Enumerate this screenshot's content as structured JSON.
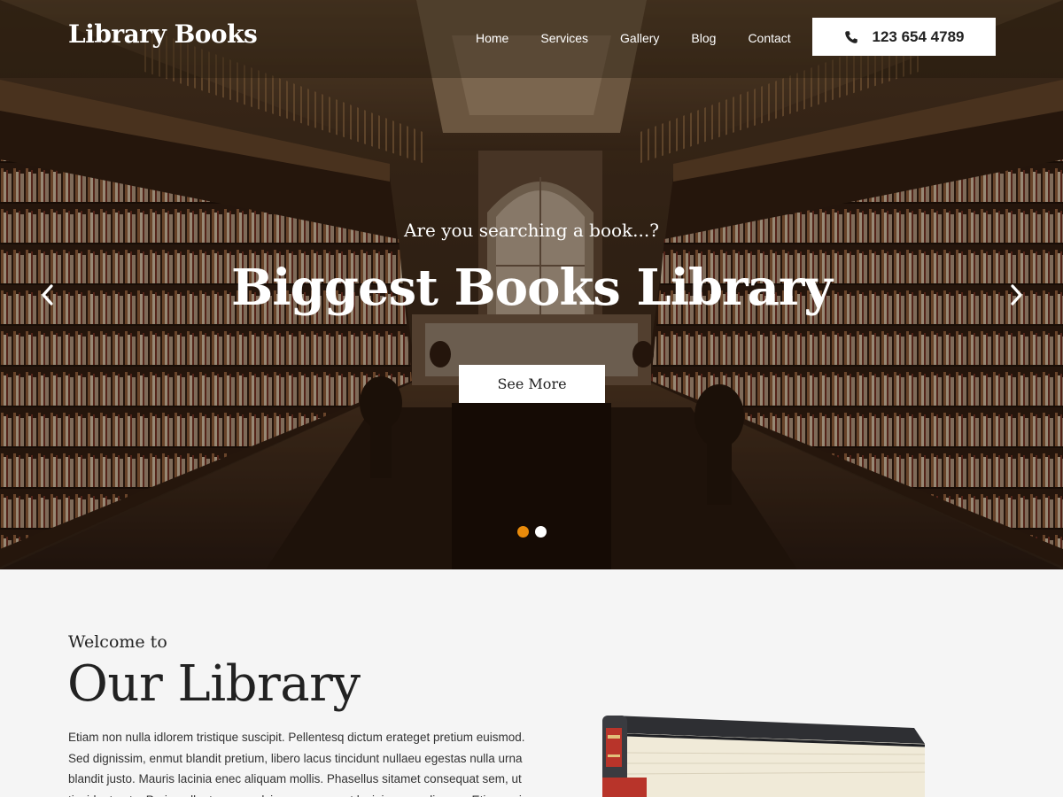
{
  "header": {
    "logo": "Library Books",
    "nav": [
      "Home",
      "Services",
      "Gallery",
      "Blog",
      "Contact"
    ],
    "phone": "123 654 4789"
  },
  "hero": {
    "subtitle": "Are you searching a book...?",
    "title": "Biggest Books Library",
    "button": "See More",
    "slides_total": 2,
    "active_slide": 1
  },
  "welcome": {
    "small": "Welcome to",
    "title": "Our Library",
    "text": "Etiam non nulla idlorem tristique suscipit. Pellentesq dictum erateget pretium euismod. Sed dignissim, enmut blandit pretium, libero lacus tincidunt nullaeu egestas nulla urna blandit justo. Mauris lacinia enec aliquam mollis. Phasellus sitamet consequat sem, ut tincidunt ante. Proin pellentesque pulvinar neque eget lacinia onec aliquam. Etiam quis"
  },
  "colors": {
    "accent": "#e98b0b",
    "text": "#222222",
    "background": "#f5f5f5"
  }
}
